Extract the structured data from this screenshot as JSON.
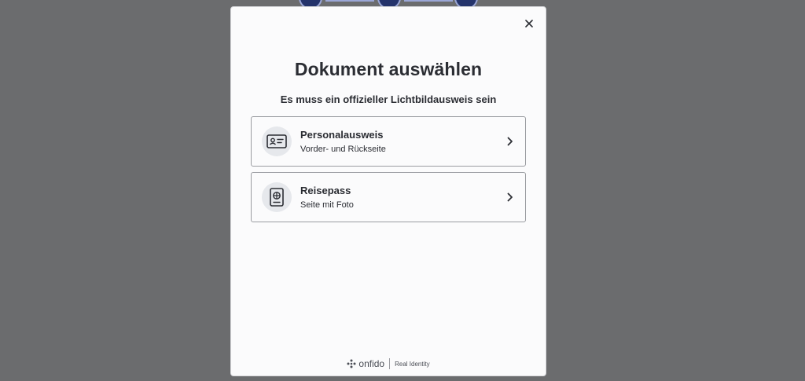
{
  "modal": {
    "title": "Dokument auswählen",
    "subtitle": "Es muss ein offizieller Lichtbildausweis sein",
    "close_icon": "close-icon"
  },
  "options": [
    {
      "label": "Personalausweis",
      "hint": "Vorder- und Rückseite",
      "icon": "id-card-icon"
    },
    {
      "label": "Reisepass",
      "hint": "Seite mit Foto",
      "icon": "passport-icon"
    }
  ],
  "footer": {
    "brand": "onfido",
    "tagline": "Real Identity"
  },
  "colors": {
    "backdrop": "#6b6c6e",
    "modal_bg": "#fbfbfc",
    "text": "#2b2d33",
    "icon_bg": "#e6e8ec",
    "border": "#9a9ca1"
  }
}
